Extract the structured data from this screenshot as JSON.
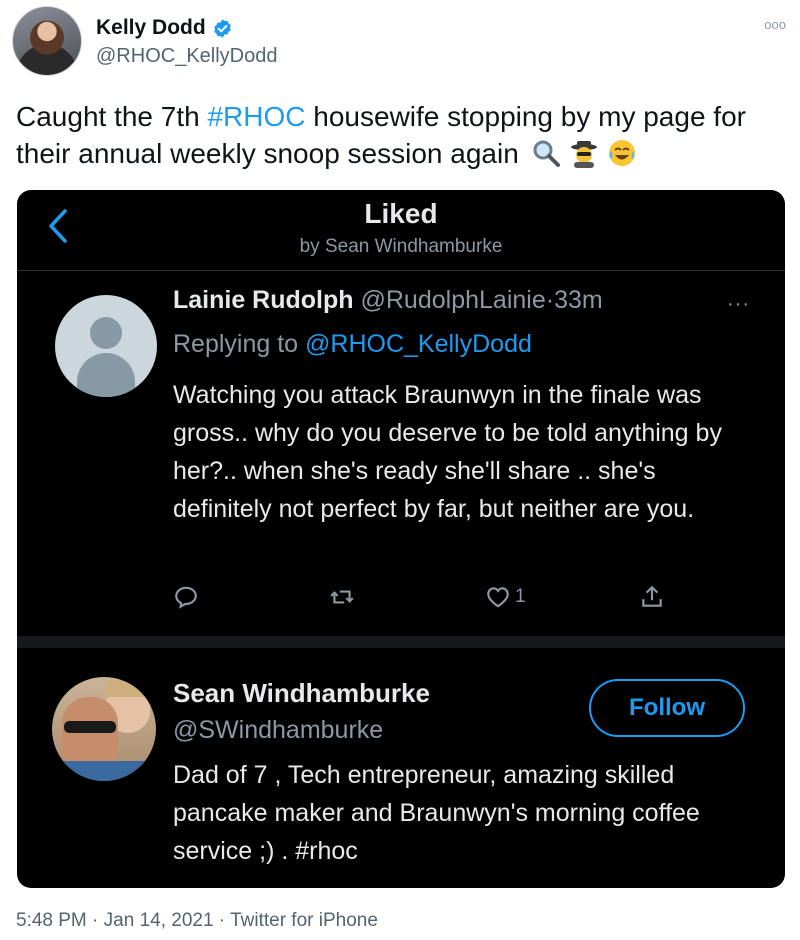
{
  "author": {
    "name": "Kelly Dodd",
    "handle": "@RHOC_KellyDodd",
    "verified_icon": "verified-badge-icon",
    "more_icon": "ooo"
  },
  "tweet": {
    "text_before": "Caught the 7th ",
    "hashtag": "#RHOC",
    "text_after": " housewife stopping by my page for their annual weekly snoop session again",
    "emojis": [
      "magnifying-glass-icon",
      "detective-icon",
      "tears-of-joy-icon"
    ]
  },
  "card": {
    "title": "Liked",
    "subtitle": "by Sean Windhamburke",
    "back_icon": "chevron-left-icon",
    "reply": {
      "name": "Lainie Rudolph",
      "handle": "@RudolphLainie",
      "separator": "·",
      "time": "33m",
      "more_icon": "···",
      "replying_label": "Replying to ",
      "replying_mention": "@RHOC_KellyDodd",
      "body": "Watching you attack Braunwyn in the finale was gross.. why do you deserve to be told anything by her?.. when she's ready she'll share .. she's definitely not perfect by far, but neither are you.",
      "actions": {
        "reply_icon": "reply-icon",
        "retweet_icon": "retweet-icon",
        "like_icon": "heart-icon",
        "like_count": "1",
        "share_icon": "share-icon"
      }
    },
    "profile": {
      "name": "Sean Windhamburke",
      "handle": "@SWindhamburke",
      "follow_label": "Follow",
      "bio": "Dad of 7 , Tech entrepreneur, amazing skilled pancake maker and Braunwyn's morning coffee service ;) . #rhoc"
    }
  },
  "footer": {
    "time": "5:48 PM",
    "separator1": " · ",
    "date": "Jan 14, 2021",
    "separator2": " · ",
    "source": "Twitter for iPhone"
  },
  "colors": {
    "accent": "#1d9bf0",
    "card_bg": "#000000",
    "muted_dark": "#8b98a5",
    "muted_light": "#536471"
  }
}
